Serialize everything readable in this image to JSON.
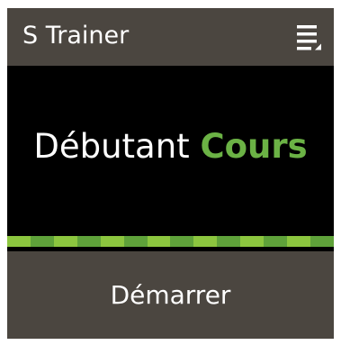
{
  "header": {
    "title": "S Trainer",
    "menu_icon": "list-menu-icon"
  },
  "main": {
    "level_label": "Débutant",
    "mode_label": "Cours"
  },
  "footer": {
    "start_label": "Démarrer"
  },
  "colors": {
    "header_background": "#4b4640",
    "screen_background": "#000000",
    "accent_green": "#6bb245",
    "strip_light": "#8cc63f",
    "strip_dark": "#5fa23a"
  }
}
